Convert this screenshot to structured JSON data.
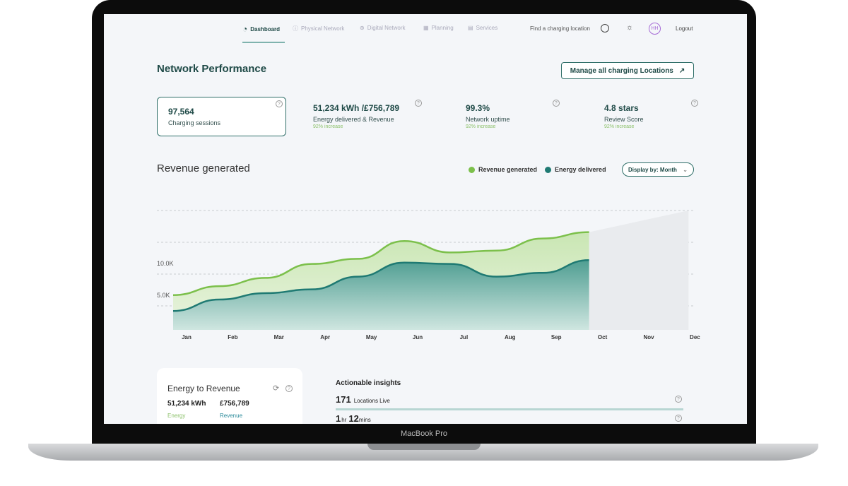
{
  "device": {
    "label": "MacBook Pro"
  },
  "nav": {
    "items": [
      {
        "label": "Dashboard",
        "icon": "pie-chart-icon",
        "active": true
      },
      {
        "label": "Physical Network",
        "icon": "bolt-circle-icon"
      },
      {
        "label": "Digital Network",
        "icon": "network-icon"
      },
      {
        "label": "Planning",
        "icon": "calendar-icon"
      },
      {
        "label": "Services",
        "icon": "grid-icon"
      }
    ],
    "search_label": "Find a charging location",
    "avatar": "HH",
    "logout": "Logout"
  },
  "header": {
    "title": "Network Performance",
    "manage_button": "Manage all charging Locations"
  },
  "kpis": [
    {
      "value": "97,564",
      "label": "Charging sessions",
      "selected": true
    },
    {
      "value": "51,234 kWh /£756,789",
      "label": "Energy delivered & Revenue",
      "change": "92% increase"
    },
    {
      "value": "99.3%",
      "label": "Network uptime",
      "change": "92% increase"
    },
    {
      "value": "4.8 stars",
      "label": "Review Score",
      "change": "92% increase"
    }
  ],
  "revenue": {
    "title": "Revenue generated",
    "display_by": "Display by: Month"
  },
  "chart_data": {
    "type": "area",
    "categories": [
      "Jan",
      "Feb",
      "Mar",
      "Apr",
      "May",
      "Jun",
      "Jul",
      "Aug",
      "Sep",
      "Oct",
      "Nov",
      "Dec"
    ],
    "yticks": [
      "5.0K",
      "10.0K"
    ],
    "ylim": [
      0,
      20000
    ],
    "grid": true,
    "legend": "top-right",
    "series": [
      {
        "name": "Revenue generated",
        "color": "#7cc04b",
        "values": [
          6700,
          8100,
          9400,
          11600,
          12400,
          15200,
          13400,
          13700,
          15600,
          16600,
          null,
          null
        ]
      },
      {
        "name": "Energy delivered",
        "color": "#1f7a73",
        "values": [
          4200,
          6000,
          7000,
          7600,
          9600,
          11800,
          11600,
          9600,
          10200,
          12200,
          null,
          null
        ]
      }
    ]
  },
  "energy_card": {
    "title": "Energy to Revenue",
    "energy_value": "51,234 kWh",
    "energy_label": "Energy",
    "revenue_value": "£756,789",
    "revenue_label": "Revenue"
  },
  "insights": {
    "title": "Actionable insights",
    "rows": [
      {
        "big": "171",
        "text": "Locations Live"
      },
      {
        "big1": "1",
        "unit1": "hr",
        "big2": "12",
        "unit2": "mins"
      }
    ]
  }
}
